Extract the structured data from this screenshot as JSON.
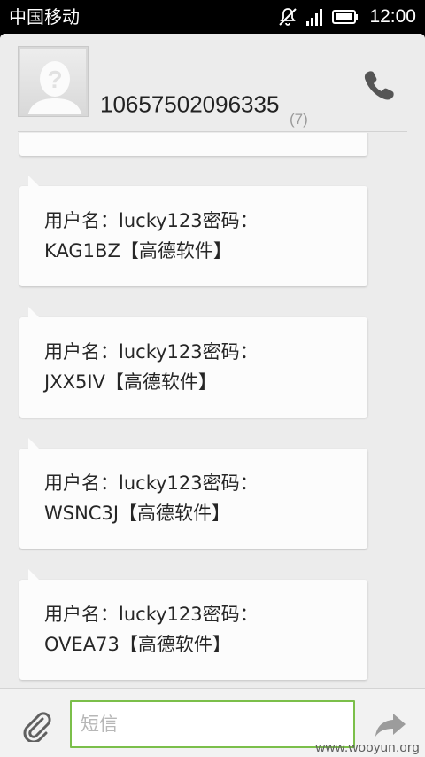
{
  "status_bar": {
    "carrier": "中国移动",
    "time": "12:00",
    "icons": [
      "mute-icon",
      "signal-icon",
      "battery-icon"
    ]
  },
  "header": {
    "contact_number": "10657502096335",
    "message_count": "(7)",
    "icons": [
      "avatar-placeholder-icon",
      "phone-icon"
    ]
  },
  "messages": [
    {
      "text": "用户名：lucky123密码：\nKAG1BZ【高德软件】"
    },
    {
      "text": "用户名：lucky123密码：\nJXX5IV【高德软件】"
    },
    {
      "text": "用户名：lucky123密码：\nWSNC3J【高德软件】"
    },
    {
      "text": "用户名：lucky123密码：\nOVEA73【高德软件】"
    }
  ],
  "composer": {
    "placeholder": "短信",
    "value": "",
    "icons": [
      "paperclip-icon",
      "send-arrow-icon"
    ]
  },
  "watermark": "www.wooyun.org",
  "colors": {
    "input_border": "#7bbf4a",
    "background": "#ececec",
    "bubble": "#fcfcfc"
  }
}
